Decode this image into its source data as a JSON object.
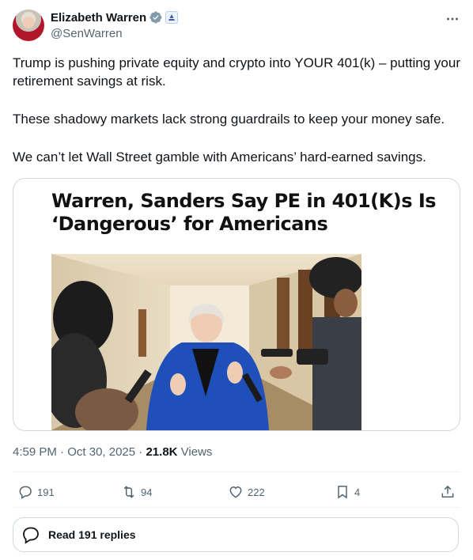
{
  "author": {
    "display_name": "Elizabeth Warren",
    "handle": "@SenWarren"
  },
  "tweet": {
    "paragraphs": [
      "Trump is pushing private equity and crypto into YOUR 401(k) – putting your retirement savings at risk.",
      "These shadowy markets lack strong guardrails to keep your money safe.",
      "We can’t let Wall Street gamble with Americans’ hard-earned savings."
    ]
  },
  "media": {
    "headline_line1": "Warren, Sanders Say PE in 401(K)s Is",
    "headline_line2": "‘Dangerous’ for Americans"
  },
  "meta": {
    "time": "4:59 PM",
    "sep": "·",
    "date": "Oct 30, 2025",
    "views_count": "21.8K",
    "views_label": "Views"
  },
  "actions": {
    "replies": "191",
    "reposts": "94",
    "likes": "222",
    "bookmarks": "4"
  },
  "read_replies": {
    "label": "Read 191 replies"
  },
  "colors": {
    "text": "#0f1419",
    "secondary": "#536471",
    "border": "#cfd9de",
    "verified": "#1d9bf0"
  },
  "icons": [
    "verified-badge-icon",
    "senate-affiliation-icon",
    "more-icon",
    "reply-icon",
    "repost-icon",
    "like-icon",
    "bookmark-icon",
    "share-icon",
    "speech-bubbles-icon"
  ]
}
